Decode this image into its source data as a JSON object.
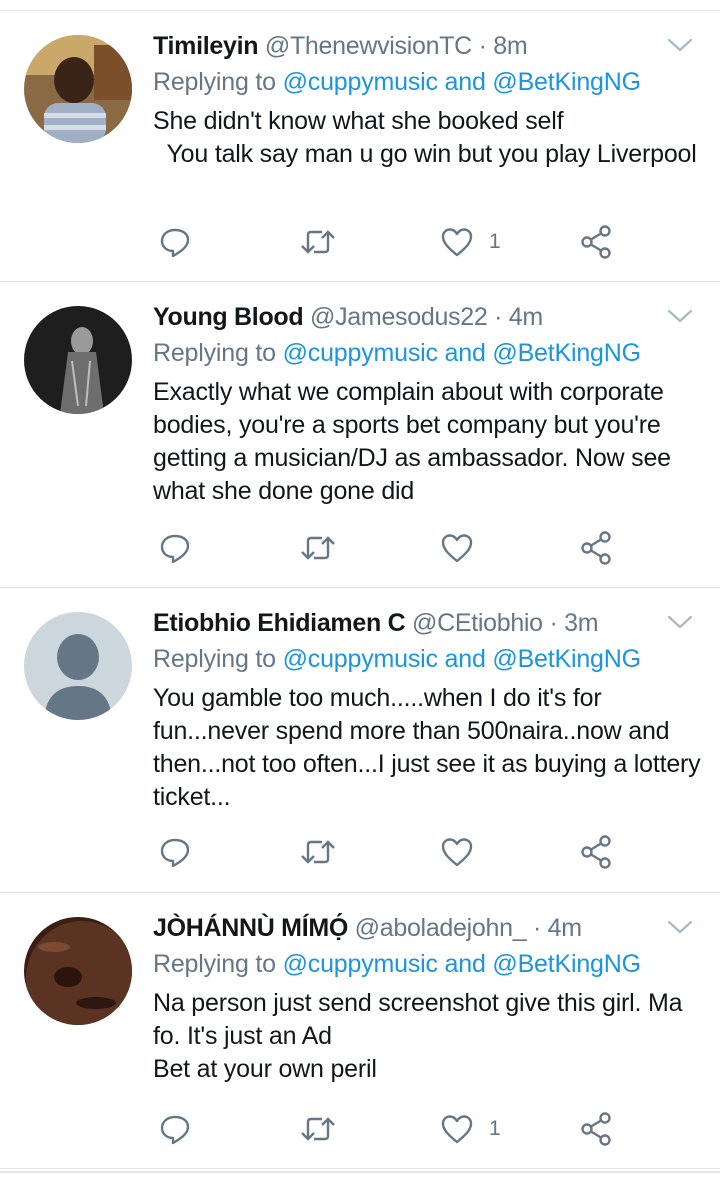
{
  "reply_prefix": "Replying to",
  "tweets": [
    {
      "name": "Timileyin",
      "handle": "@ThenewvisionTC",
      "time": "· 8m",
      "mentions": "@cuppymusic and @BetKingNG",
      "text": "She didn't know what she booked self\n  You talk say man u go win but you play Liverpool",
      "likes": "1"
    },
    {
      "name": "Young Blood",
      "handle": "@Jamesodus22",
      "time": "· 4m",
      "mentions": "@cuppymusic and @BetKingNG",
      "text": "Exactly what we complain about with corporate bodies, you're a sports bet company but you're getting a musician/DJ as ambassador. Now see what she done gone did",
      "likes": ""
    },
    {
      "name": "Etiobhio Ehidiamen C",
      "handle": "@CEtiobhio",
      "time": "· 3m",
      "mentions": "@cuppymusic and @BetKingNG",
      "text": "You gamble too much.....when I do it's for fun...never spend more than 500naira..now and then...not too often...I just see it as buying a lottery ticket...",
      "likes": ""
    },
    {
      "name": "JÒHÁNNÙ MÍMỌ́",
      "handle": "@aboladejohn_",
      "time": "· 4m",
      "mentions": "@cuppymusic and @BetKingNG",
      "text": "Na person just send screenshot give this girl. Ma fo. It's just an Ad\nBet at your own peril",
      "likes": "1"
    }
  ],
  "colors": {
    "link": "#1b95e0",
    "secondary": "#657786",
    "divider": "#e1e8ed"
  },
  "icons": [
    "reply-icon",
    "retweet-icon",
    "like-icon",
    "share-icon",
    "caret-down-icon"
  ]
}
